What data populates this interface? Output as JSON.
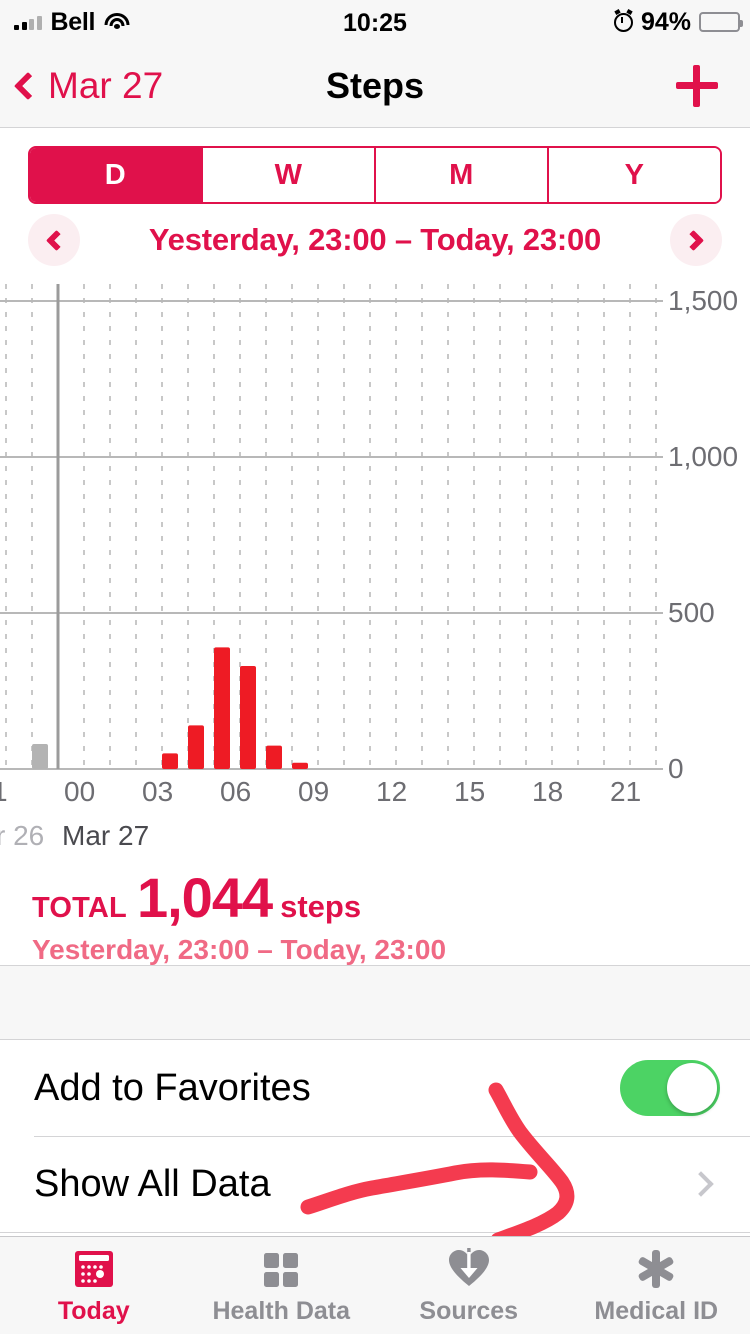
{
  "status_bar": {
    "carrier": "Bell",
    "time": "10:25",
    "battery_percent": "94%",
    "signal_icon": "cellular-signal-icon",
    "wifi_icon": "wifi-icon",
    "alarm_icon": "alarm-clock-icon",
    "battery_icon": "battery-icon"
  },
  "nav": {
    "back_label": "Mar 27",
    "title": "Steps",
    "add_icon": "plus-icon",
    "back_icon": "chevron-left-icon"
  },
  "segmented": {
    "options": [
      "D",
      "W",
      "M",
      "Y"
    ],
    "selected_index": 0
  },
  "range": {
    "label": "Yesterday, 23:00 – Today, 23:00",
    "prev_icon": "chevron-left-icon",
    "next_icon": "chevron-right-icon"
  },
  "total": {
    "word": "TOTAL",
    "value": "1,044",
    "unit": "steps",
    "subtitle": "Yesterday, 23:00 – Today, 23:00"
  },
  "list": {
    "rows": [
      {
        "label": "Add to Favorites",
        "control": "toggle",
        "toggle_on": true
      },
      {
        "label": "Show All Data",
        "control": "chevron"
      }
    ]
  },
  "tabs": [
    {
      "label": "Today",
      "icon": "calendar-icon",
      "active": true
    },
    {
      "label": "Health Data",
      "icon": "grid-squares-icon",
      "active": false
    },
    {
      "label": "Sources",
      "icon": "heart-download-icon",
      "active": false
    },
    {
      "label": "Medical ID",
      "icon": "asterisk-icon",
      "active": false
    }
  ],
  "colors": {
    "brand_red": "#e0114b",
    "brand_red_light": "#f06a85",
    "bar_red": "#ee1b24",
    "bar_gray": "#b3b3b3",
    "toggle_green": "#4cd364",
    "grid_gray": "#c8c8c8",
    "axis_text": "#6d6d72",
    "annotation_red": "#f43b4f"
  },
  "annotation": {
    "shape": "hand-drawn-arrow",
    "color": "#f43b4f",
    "target": "Show All Data"
  },
  "chart_data": {
    "type": "bar",
    "title": "Steps",
    "xlabel": "",
    "ylabel": "",
    "ylim": [
      0,
      1500
    ],
    "yticks": [
      0,
      500,
      1000,
      1500
    ],
    "ytick_labels": [
      "0",
      "500",
      "1,000",
      "1,500"
    ],
    "xtick_labels": [
      "1",
      "00",
      "03",
      "06",
      "09",
      "12",
      "15",
      "18",
      "21"
    ],
    "x_axis_note": "hours, 23:00 yesterday through 23:00 today",
    "day_labels": [
      "r 26",
      "Mar 27"
    ],
    "grid": true,
    "total_steps": 1044,
    "categories": [
      "23",
      "04",
      "05",
      "06",
      "07",
      "08",
      "09"
    ],
    "values": [
      80,
      50,
      140,
      390,
      330,
      75,
      20
    ],
    "series": [
      {
        "name": "Previous day (Mar 26)",
        "color": "#b3b3b3",
        "points": [
          {
            "hour": "23",
            "value": 80
          }
        ]
      },
      {
        "name": "Mar 27 steps",
        "color": "#ee1b24",
        "points": [
          {
            "hour": "04",
            "value": 50
          },
          {
            "hour": "05",
            "value": 140
          },
          {
            "hour": "06",
            "value": 390
          },
          {
            "hour": "07",
            "value": 330
          },
          {
            "hour": "08",
            "value": 75
          },
          {
            "hour": "09",
            "value": 20
          }
        ]
      }
    ]
  }
}
